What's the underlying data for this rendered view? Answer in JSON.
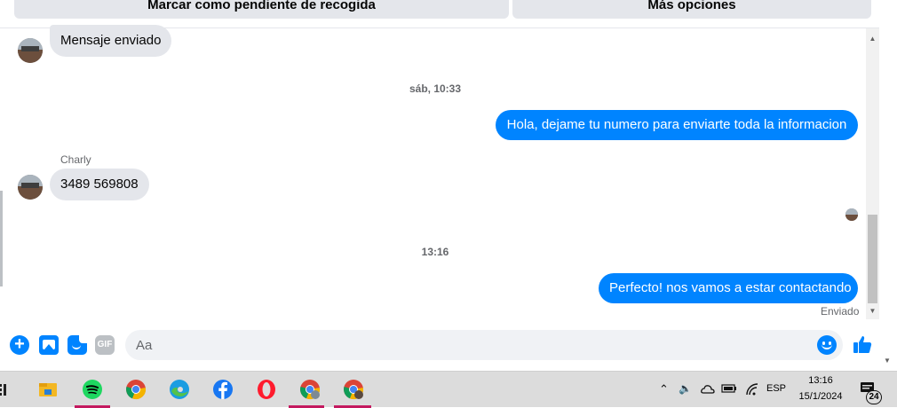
{
  "top_actions": {
    "mark_pending_label": "Marcar como pendiente de recogida",
    "more_options_label": "Más opciones"
  },
  "conversation": {
    "first_incoming": "Mensaje enviado",
    "timestamp_1": "sáb, 10:33",
    "outgoing_1": "Hola, dejame tu numero para enviarte toda la informacion",
    "sender_name": "Charly",
    "incoming_phone": "3489 569808",
    "timestamp_2": "13:16",
    "outgoing_2": "Perfecto! nos vamos a estar contactando",
    "status": "Enviado"
  },
  "composer": {
    "placeholder": "Aa",
    "gif_label": "GIF"
  },
  "taskbar": {
    "language": "ESP",
    "time": "13:16",
    "date": "15/1/2024",
    "notification_count": "24"
  },
  "colors": {
    "messenger_blue": "#0084ff",
    "incoming_bubble": "#e4e6eb",
    "taskbar": "#dcdcdc"
  }
}
